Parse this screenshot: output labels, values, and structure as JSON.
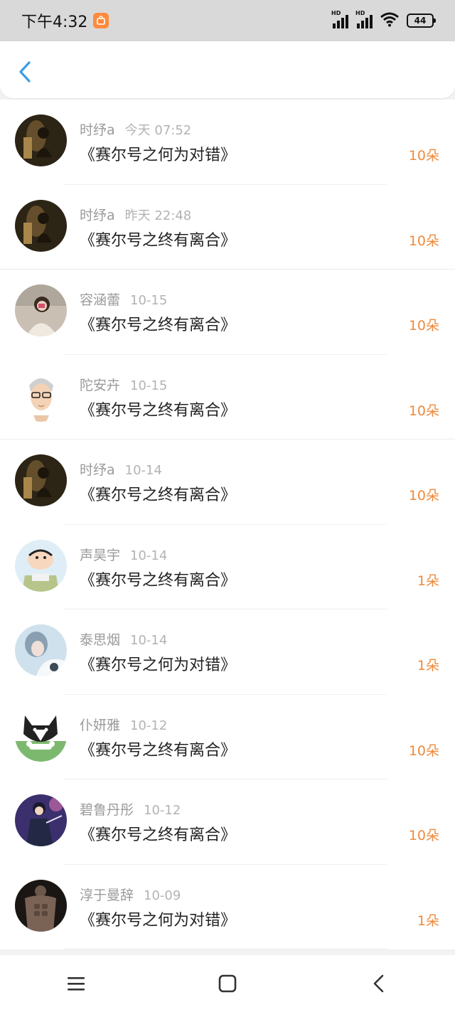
{
  "status_bar": {
    "time": "下午4:32",
    "battery": "44",
    "icons": [
      "app-badge-icon",
      "hd-signal-icon",
      "hd-signal-icon",
      "wifi-icon",
      "battery-icon"
    ]
  },
  "header": {
    "back_icon": "chevron-left-icon"
  },
  "colors": {
    "accent": "#3a9ee8",
    "count": "#ef8a3c",
    "name": "#9a9a9a",
    "time": "#b3b3b3"
  },
  "gifts": [
    {
      "name": "时纾a",
      "time": "今天 07:52",
      "title": "《赛尔号之何为对错》",
      "count": "10朵"
    },
    {
      "name": "时纾a",
      "time": "昨天 22:48",
      "title": "《赛尔号之终有离合》",
      "count": "10朵"
    },
    {
      "name": "容涵蕾",
      "time": "10-15",
      "title": "《赛尔号之终有离合》",
      "count": "10朵"
    },
    {
      "name": "陀安卉",
      "time": "10-15",
      "title": "《赛尔号之终有离合》",
      "count": "10朵"
    },
    {
      "name": "时纾a",
      "time": "10-14",
      "title": "《赛尔号之终有离合》",
      "count": "10朵"
    },
    {
      "name": "声昊宇",
      "time": "10-14",
      "title": "《赛尔号之终有离合》",
      "count": "1朵"
    },
    {
      "name": "泰思烟",
      "time": "10-14",
      "title": "《赛尔号之何为对错》",
      "count": "1朵"
    },
    {
      "name": "仆妍雅",
      "time": "10-12",
      "title": "《赛尔号之终有离合》",
      "count": "10朵"
    },
    {
      "name": "碧鲁丹彤",
      "time": "10-12",
      "title": "《赛尔号之终有离合》",
      "count": "10朵"
    },
    {
      "name": "淳于曼辞",
      "time": "10-09",
      "title": "《赛尔号之何为对错》",
      "count": "1朵"
    }
  ],
  "navbar": {
    "icons": [
      "menu-icon",
      "home-square-icon",
      "back-triangle-icon"
    ]
  }
}
